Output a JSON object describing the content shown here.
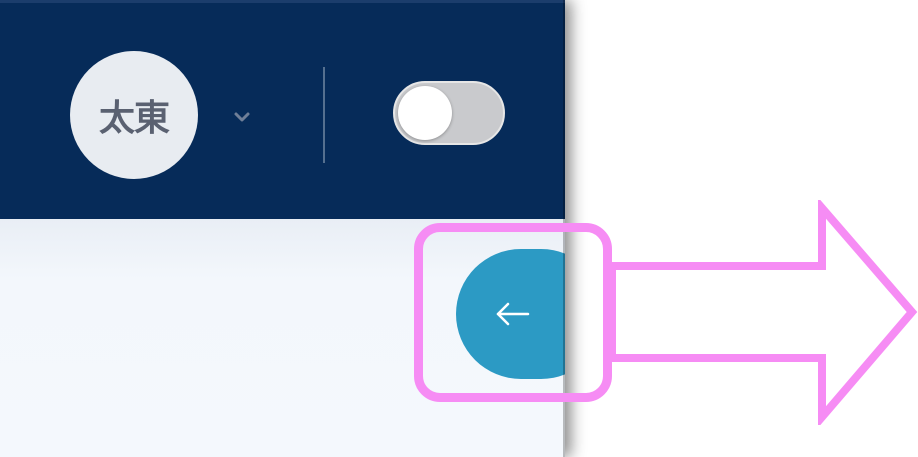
{
  "header": {
    "avatar": {
      "initials": "太東"
    },
    "user_menu_icon": "chevron-down-icon",
    "theme_toggle": {
      "state": "off"
    }
  },
  "sidebar": {
    "collapse_button": {
      "icon": "arrow-left-icon"
    }
  },
  "annotation": {
    "highlight_color": "#f68cf4",
    "arrow_direction": "right"
  },
  "colors": {
    "header_bg": "#062b59",
    "content_bg": "#f3f7fc",
    "accent": "#2c9ac4",
    "toggle_track": "#c9cacd",
    "avatar_bg": "#e8ecf1"
  }
}
